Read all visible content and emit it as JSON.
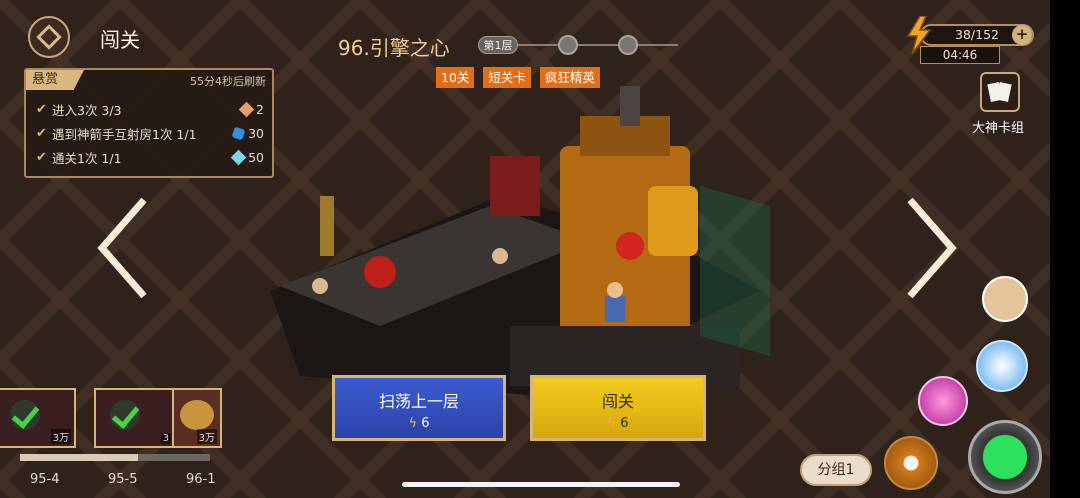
{
  "header": {
    "title": "闯关",
    "logo_icon": "diamond-eye-icon"
  },
  "bounty": {
    "tag": "悬赏",
    "refresh": "55分4秒后刷新",
    "tasks": [
      {
        "text": "进入3次 3/3",
        "reward": "2",
        "reward_icon": "orange-gem-icon"
      },
      {
        "text": "遇到神箭手互射房1次 1/1",
        "reward": "30",
        "reward_icon": "blue-crystal-icon"
      },
      {
        "text": "通关1次 1/1",
        "reward": "50",
        "reward_icon": "cyan-gem-icon"
      }
    ]
  },
  "level": {
    "name": "96.引擎之心",
    "floor_label": "第1层",
    "tags": [
      "10关",
      "短关卡",
      "疯狂精英"
    ]
  },
  "stamina": {
    "value": "38/152",
    "timer": "04:46"
  },
  "deck": {
    "label": "大神卡组"
  },
  "stages": [
    {
      "label": "95-4",
      "amount": "3万",
      "cleared": true
    },
    {
      "label": "95-5",
      "amount": "3",
      "cleared": true
    },
    {
      "label": "96-1",
      "amount": "3万",
      "cleared": false
    }
  ],
  "stage_progress": 0.62,
  "buttons": {
    "sweep": {
      "title": "扫荡上一层",
      "cost": "6"
    },
    "fight": {
      "title": "闯关",
      "cost": "6"
    },
    "group": "分组1"
  },
  "colors": {
    "accent": "#d8b47a",
    "tag": "#e06f18",
    "sweep": "#3d5bd0",
    "fight": "#f2cc1e"
  }
}
